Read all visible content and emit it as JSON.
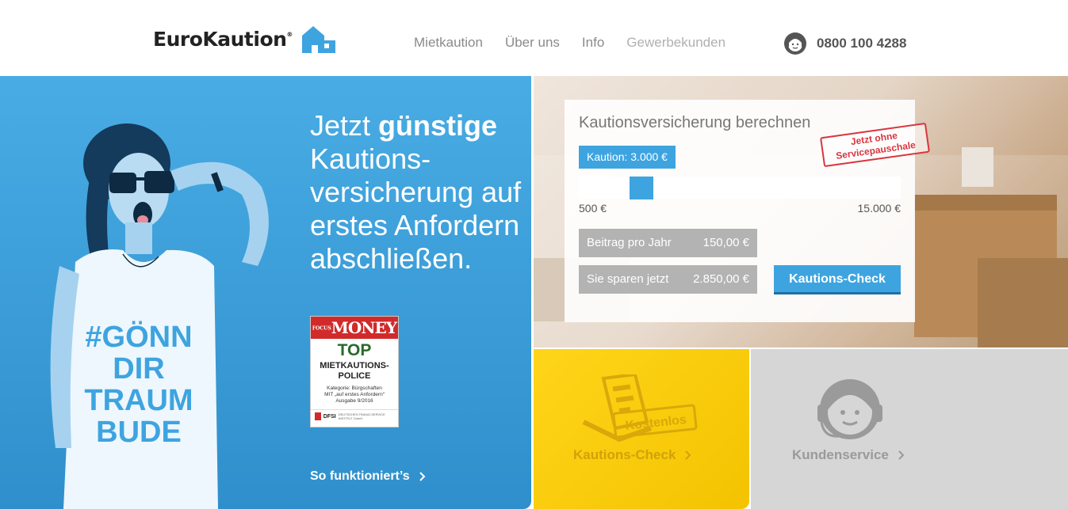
{
  "header": {
    "brand": "EuroKaution",
    "brand_mark": "®",
    "nav": [
      "Mietkaution",
      "Über uns",
      "Info",
      "Gewerbekunden"
    ],
    "phone": "0800 100 4288"
  },
  "hero": {
    "title_pre": "Jetzt ",
    "title_bold": "günstige",
    "title_rest": "Kautions-versicherung auf erstes Anfordern abschließen.",
    "tshirt_lines": [
      "#GÖNN",
      "DIR",
      "TRAUM",
      "BUDE"
    ],
    "cta": "So funktioniert’s",
    "badge": {
      "header": "MONEY",
      "header_small": "FOCUS",
      "top": "TOP",
      "policy_line1": "MIETKAUTIONS-",
      "policy_line2": "POLICE",
      "meta1": "Kategorie: Bürgschaften",
      "meta2": "MIT „auf erstes Anfordern“",
      "meta3": "Ausgabe 9/2016",
      "footer": "DFSI",
      "footer_sub": "DEUTSCHES FINANZ-SERVICE INSTITUT GmbH"
    }
  },
  "calculator": {
    "title": "Kautionsversicherung berechnen",
    "stamp_line1": "Jetzt ohne",
    "stamp_line2": "Servicepauschale",
    "kaution_label": "Kaution: 3.000 €",
    "slider_min": "500 €",
    "slider_max": "15.000 €",
    "slider_value": 3000,
    "beitrag_label": "Beitrag pro Jahr",
    "beitrag_value": "150,00 €",
    "sparen_label": "Sie sparen jetzt",
    "sparen_value": "2.850,00 €",
    "check_button": "Kautions-Check"
  },
  "tiles": {
    "yellow_label": "Kautions-Check",
    "yellow_badge": "Kostenlos",
    "gray_label": "Kundenservice"
  },
  "colors": {
    "blue": "#3ea4e0",
    "yellow": "#ffd51a",
    "gray": "#d6d6d6",
    "stamp_red": "#d9353f"
  }
}
